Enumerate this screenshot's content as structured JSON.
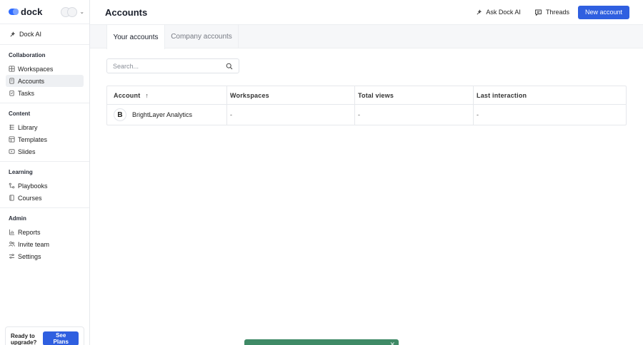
{
  "app": {
    "logo_text": "dock"
  },
  "sidebar": {
    "ai_item": "Dock AI",
    "sections": [
      {
        "title": "Collaboration",
        "items": [
          {
            "label": "Workspaces",
            "icon": "workspaces-icon"
          },
          {
            "label": "Accounts",
            "icon": "accounts-icon",
            "active": true
          },
          {
            "label": "Tasks",
            "icon": "tasks-icon"
          }
        ]
      },
      {
        "title": "Content",
        "items": [
          {
            "label": "Library",
            "icon": "library-icon"
          },
          {
            "label": "Templates",
            "icon": "templates-icon"
          },
          {
            "label": "Slides",
            "icon": "slides-icon"
          }
        ]
      },
      {
        "title": "Learning",
        "items": [
          {
            "label": "Playbooks",
            "icon": "playbooks-icon"
          },
          {
            "label": "Courses",
            "icon": "courses-icon"
          }
        ]
      },
      {
        "title": "Admin",
        "items": [
          {
            "label": "Reports",
            "icon": "reports-icon"
          },
          {
            "label": "Invite team",
            "icon": "invite-team-icon"
          },
          {
            "label": "Settings",
            "icon": "settings-icon"
          }
        ]
      }
    ],
    "upgrade": {
      "text": "Ready to upgrade?",
      "button": "See Plans"
    }
  },
  "header": {
    "title": "Accounts",
    "ask_ai": "Ask Dock AI",
    "threads": "Threads",
    "new_account": "New account"
  },
  "tabs": [
    {
      "label": "Your accounts",
      "active": true
    },
    {
      "label": "Company accounts",
      "active": false
    }
  ],
  "search": {
    "placeholder": "Search...",
    "value": ""
  },
  "table": {
    "columns": [
      "Account",
      "Workspaces",
      "Total views",
      "Last interaction"
    ],
    "rows": [
      {
        "avatar": "B",
        "account": "BrightLayer Analytics",
        "workspaces": "-",
        "total_views": "-",
        "last_interaction": "-"
      }
    ]
  },
  "colors": {
    "accent": "#2f5fe0",
    "toast": "#3f8a66"
  }
}
